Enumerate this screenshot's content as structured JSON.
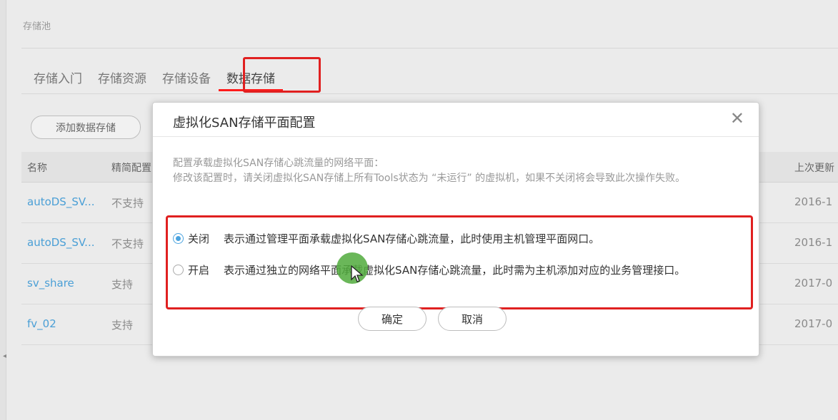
{
  "breadcrumb": "存储池",
  "tabs": [
    {
      "label": "存储入门"
    },
    {
      "label": "存储资源"
    },
    {
      "label": "存储设备"
    },
    {
      "label": "数据存储"
    }
  ],
  "add_button": "添加数据存储",
  "table": {
    "headers": [
      "名称",
      "精简配置",
      "上次更新"
    ],
    "rows": [
      {
        "name": "autoDS_SV...",
        "thin": "不支持",
        "updated": "2016-1"
      },
      {
        "name": "autoDS_SV...",
        "thin": "不支持",
        "updated": "2016-1"
      },
      {
        "name": "sv_share",
        "thin": "支持",
        "updated": "2017-0"
      },
      {
        "name": "fv_02",
        "thin": "支持",
        "updated": "2017-0"
      }
    ]
  },
  "dialog": {
    "title": "虚拟化SAN存储平面配置",
    "close_icon": "close-icon",
    "desc_line1": "配置承载虚拟化SAN存储心跳流量的网络平面：",
    "desc_line2": "修改该配置时，请关闭虚拟化SAN存储上所有Tools状态为 “未运行” 的虚拟机，如果不关闭将会导致此次操作失败。",
    "options": [
      {
        "label": "关闭",
        "text": "表示通过管理平面承载虚拟化SAN存储心跳流量，此时使用主机管理平面网口。",
        "checked": true
      },
      {
        "label": "开启",
        "text": "表示通过独立的网络平面承载虚拟化SAN存储心跳流量，此时需为主机添加对应的业务管理接口。",
        "checked": false
      }
    ],
    "ok": "确定",
    "cancel": "取消"
  },
  "colors": {
    "accent": "#4aa3df",
    "highlight": "#e02020",
    "link": "#4a9fd6"
  }
}
